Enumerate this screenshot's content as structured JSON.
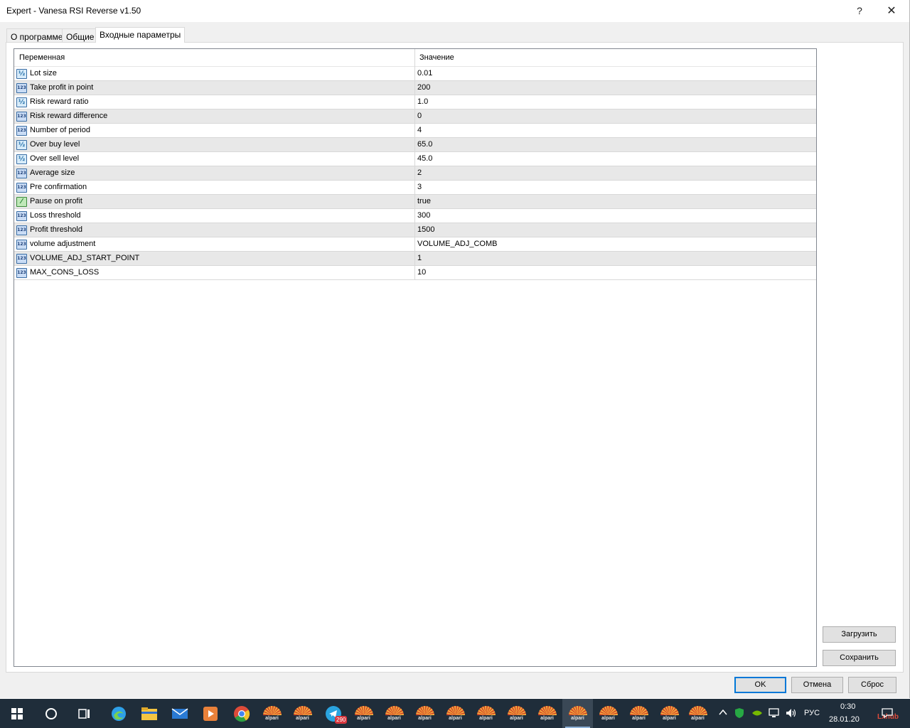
{
  "window": {
    "title": "Expert - Vanesa RSI Reverse v1.50",
    "help_glyph": "?",
    "close_glyph": "✕"
  },
  "tabs": [
    {
      "label": "О программе",
      "active": false
    },
    {
      "label": "Общие",
      "active": false
    },
    {
      "label": "Входные параметры",
      "active": true
    }
  ],
  "grid": {
    "columns": [
      "Переменная",
      "Значение"
    ],
    "rows": [
      {
        "type": "double",
        "icon": "double-icon",
        "name": "Lot size",
        "value": "0.01"
      },
      {
        "type": "int",
        "icon": "int-icon",
        "name": "Take profit in point",
        "value": "200"
      },
      {
        "type": "double",
        "icon": "double-icon",
        "name": "Risk reward ratio",
        "value": "1.0"
      },
      {
        "type": "int",
        "icon": "int-icon",
        "name": "Risk reward difference",
        "value": "0"
      },
      {
        "type": "int",
        "icon": "int-icon",
        "name": "Number of period",
        "value": "4"
      },
      {
        "type": "double",
        "icon": "double-icon",
        "name": "Over buy level",
        "value": "65.0"
      },
      {
        "type": "double",
        "icon": "double-icon",
        "name": "Over sell level",
        "value": "45.0"
      },
      {
        "type": "int",
        "icon": "int-icon",
        "name": "Average size",
        "value": "2"
      },
      {
        "type": "int",
        "icon": "int-icon",
        "name": "Pre confirmation",
        "value": "3"
      },
      {
        "type": "bool",
        "icon": "bool-icon",
        "name": "Pause on profit",
        "value": "true"
      },
      {
        "type": "int",
        "icon": "int-icon",
        "name": "Loss threshold",
        "value": "300"
      },
      {
        "type": "int",
        "icon": "int-icon",
        "name": "Profit threshold",
        "value": "1500"
      },
      {
        "type": "int",
        "icon": "int-icon",
        "name": "volume adjustment",
        "value": "VOLUME_ADJ_COMB"
      },
      {
        "type": "int",
        "icon": "int-icon",
        "name": "VOLUME_ADJ_START_POINT",
        "value": "1"
      },
      {
        "type": "int",
        "icon": "int-icon",
        "name": "MAX_CONS_LOSS",
        "value": "10"
      }
    ]
  },
  "side_buttons": {
    "load": "Загрузить",
    "save": "Сохранить"
  },
  "dialog_buttons": {
    "ok": "OK",
    "cancel": "Отмена",
    "reset": "Сброс"
  },
  "taskbar": {
    "telegram_badge": "290",
    "alpari_label": "alpari",
    "language": "РУС",
    "time": "0:30",
    "date": "28.01.20",
    "watermark": "Lxhub"
  },
  "colors": {
    "accent": "#0078d7",
    "taskbar_bg": "#1f2d3a",
    "alt_row": "#e8e8e8"
  }
}
